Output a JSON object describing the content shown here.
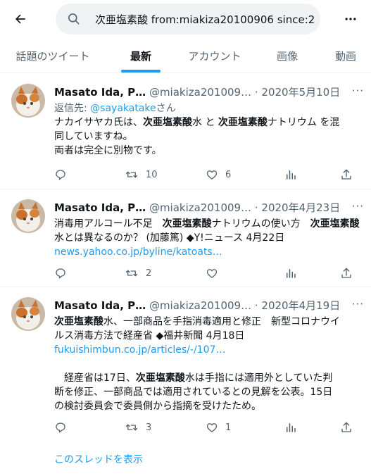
{
  "search": {
    "query": "次亜塩素酸 from:miakiza20100906 since:2"
  },
  "tabs": [
    "話題のツイート",
    "最新",
    "アカウント",
    "画像",
    "動画"
  ],
  "active_tab": "最新",
  "tweets": [
    {
      "name": "Masato Ida, P…",
      "handle": "@miakiza201009…",
      "date": "2020年5月10日",
      "reply_prefix": "返信先: ",
      "reply_handle": "@sayakatake",
      "reply_suffix": "さん",
      "line1a": "ナカイサヤカ氏は、",
      "kw": "次亜塩素酸",
      "line1b": "水 と ",
      "line1c": "ナトリウム を混",
      "line2": "同していますね。",
      "line3": "両者は完全に別物です。",
      "actions": {
        "reply": "",
        "retweet": "10",
        "like": "6"
      }
    },
    {
      "name": "Masato Ida, P…",
      "handle": "@miakiza201009…",
      "date": "2020年4月23日",
      "line1a": "消毒用アルコール不足　",
      "kw": "次亜塩素酸",
      "line1b": "ナトリウムの使い方　",
      "line2b": "水とは異なるのか？ (加藤篤) ◆Y!ニュース 4月22日",
      "link": "news.yahoo.co.jp/byline/katoats…",
      "actions": {
        "reply": "",
        "retweet": "2",
        "like": ""
      }
    },
    {
      "name": "Masato Ida, P…",
      "handle": "@miakiza201009…",
      "date": "2020年4月19日",
      "kw": "次亜塩素酸",
      "line1b": "水、一部商品を手指消毒適用と修正　新型コロナウイ",
      "line2": "ルス消毒方法で経産省 ◆福井新聞 4月18日",
      "link": "fukuishimbun.co.jp/articles/-/107…",
      "para_a": "　経産省は17日、",
      "para_b": "水は手指には適用外としていた判",
      "para_line2": "断を修正、一部商品では適用されているとの見解を公表。15日",
      "para_line3": "の検討委員会で委員側から指摘を受けたため。",
      "actions": {
        "reply": "",
        "retweet": "3",
        "like": "1"
      }
    }
  ],
  "show_thread": "このスレッドを表示",
  "colors": {
    "accent": "#1d9bf0",
    "muted": "#536471",
    "text": "#0f1419",
    "search_bg": "#eff3f4"
  },
  "icons": [
    "back-arrow-icon",
    "search-icon",
    "more-icon",
    "reply-icon",
    "retweet-icon",
    "like-icon",
    "analytics-icon",
    "share-icon"
  ]
}
